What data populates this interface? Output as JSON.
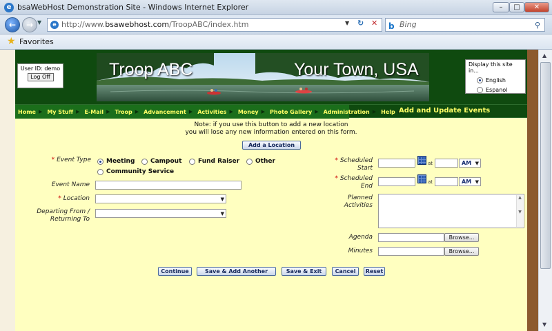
{
  "window": {
    "title": "bsaWebHost Demonstration Site - Windows Internet Explorer",
    "min_label": "–",
    "max_label": "□",
    "close_label": "✕"
  },
  "browser": {
    "url_prefix": "http://www.",
    "url_domain": "bsawebhost.com",
    "url_path": "/TroopABC/index.htm",
    "search_engine": "Bing",
    "favorites_label": "Favorites",
    "back_icon": "back-arrow-icon",
    "forward_icon": "forward-arrow-icon"
  },
  "header": {
    "user_id_label": "User ID: demo",
    "logoff_label": "Log Off",
    "banner_left": "Troop ABC",
    "banner_right": "Your Town, USA",
    "lang_title": "Display this site in...",
    "lang_options": [
      {
        "label": "English",
        "selected": true
      },
      {
        "label": "Espanol",
        "selected": false
      }
    ]
  },
  "nav": {
    "items": [
      "Home",
      "My Stuff",
      "E-Mail",
      "Troop",
      "Advancement",
      "Activities",
      "Money",
      "Photo Gallery",
      "Administration",
      "Help"
    ],
    "page_title": "Add and Update Events"
  },
  "form": {
    "note_line1": "Note: if you use this button to add a new location",
    "note_line2": "you will lose any new information entered on this form.",
    "add_location_label": "Add a Location",
    "event_type_label": "Event Type",
    "event_types": [
      {
        "label": "Meeting",
        "selected": true
      },
      {
        "label": "Campout",
        "selected": false
      },
      {
        "label": "Fund Raiser",
        "selected": false
      },
      {
        "label": "Other",
        "selected": false
      },
      {
        "label": "Community Service",
        "selected": false
      }
    ],
    "event_name_label": "Event Name",
    "event_name_value": "",
    "location_label": "Location",
    "location_value": "",
    "departing_label_1": "Departing From /",
    "departing_label_2": "Returning To",
    "departing_value": "",
    "sched_start_1": "Scheduled",
    "sched_start_2": "Start",
    "sched_end_1": "Scheduled",
    "sched_end_2": "End",
    "at_label": "at",
    "start_ampm": "AM",
    "end_ampm": "AM",
    "planned_1": "Planned",
    "planned_2": "Activities",
    "agenda_label": "Agenda",
    "minutes_label": "Minutes",
    "browse_label": "Browse...",
    "required_mark": "*"
  },
  "buttons": {
    "continue": "Continue",
    "save_add": "Save & Add Another",
    "save_exit": "Save & Exit",
    "cancel": "Cancel",
    "reset": "Reset"
  },
  "colors": {
    "page_bg": "#ffffc0",
    "header_bg": "#0f4a0f",
    "nav_text": "#ffff66",
    "required": "#cc0000"
  }
}
